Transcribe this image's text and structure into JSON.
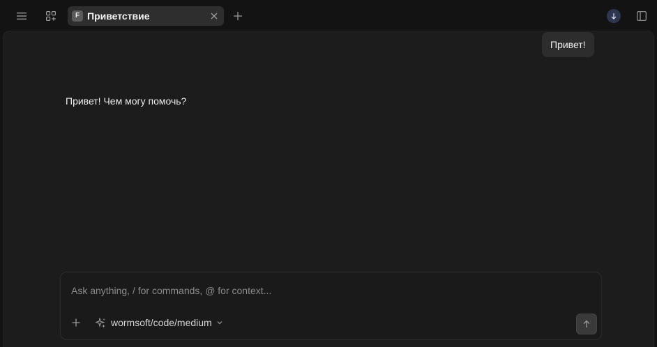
{
  "topbar": {
    "menu_icon": "hamburger-menu-icon",
    "apps_icon": "apps-grid-icon",
    "tab": {
      "badge": "F",
      "title": "Приветствие",
      "close_icon": "close-icon"
    },
    "new_tab_icon": "plus-icon",
    "download_icon": "arrow-down-icon",
    "sidebar_icon": "sidebar-panel-icon"
  },
  "chat": {
    "user_message": "Привет!",
    "assistant_message": "Привет! Чем могу помочь?"
  },
  "composer": {
    "placeholder": "Ask anything, / for commands, @ for context...",
    "value": "",
    "attach_icon": "plus-icon",
    "model_icon": "sparkles-icon",
    "model_label": "wormsoft/code/medium",
    "send_icon": "arrow-up-icon"
  },
  "colors": {
    "background": "#131313",
    "panel": "#1c1c1c",
    "tab_background": "#2e2e2e",
    "bubble": "#2d2d2d",
    "avatar_accent": "#2f3650"
  }
}
